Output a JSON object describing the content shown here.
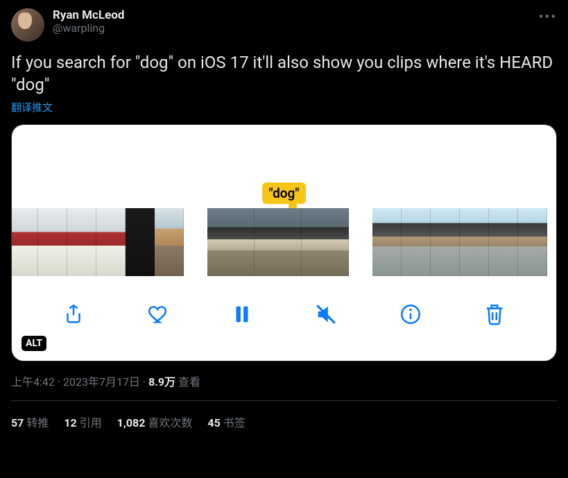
{
  "author": {
    "display_name": "Ryan McLeod",
    "handle": "@warpling"
  },
  "tweet_text": "If you search for \"dog\" on iOS 17 it'll also show you clips where it's HEARD \"dog\"",
  "translate_label": "翻译推文",
  "media": {
    "search_tag": "\"dog\"",
    "alt_badge": "ALT"
  },
  "meta": {
    "time": "上午4:42",
    "date": "2023年7月17日",
    "views_count": "8.9万",
    "views_label": "查看"
  },
  "stats": {
    "reposts_count": "57",
    "reposts_label": "转推",
    "quotes_count": "12",
    "quotes_label": "引用",
    "likes_count": "1,082",
    "likes_label": "喜欢次数",
    "bookmarks_count": "45",
    "bookmarks_label": "书签"
  }
}
